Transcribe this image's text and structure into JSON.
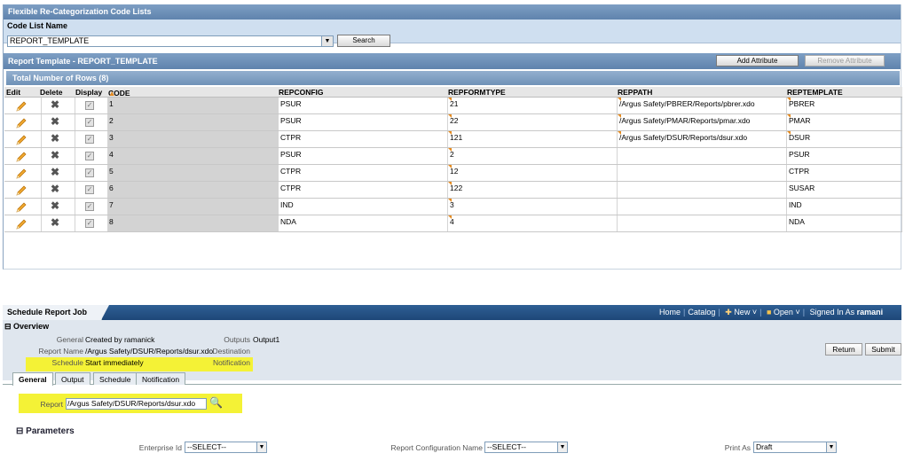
{
  "top": {
    "title": "Flexible Re-Categorization Code Lists",
    "code_list_label": "Code List Name",
    "code_list_value": "REPORT_TEMPLATE",
    "search_label": "Search",
    "report_template_title": "Report Template - REPORT_TEMPLATE",
    "add_attribute_label": "Add Attribute",
    "remove_attribute_label": "Remove Attribute",
    "total_rows": "Total Number of Rows (8)",
    "columns": [
      "Edit",
      "Delete",
      "Display",
      "CODE",
      "REPCONFIG",
      "REPFORMTYPE",
      "REPPATH",
      "REPTEMPLATE"
    ],
    "rows": [
      {
        "code": "1",
        "repconfig": "PSUR",
        "repformtype": "21",
        "reppath": "/Argus Safety/PBRER/Reports/pbrer.xdo",
        "reptemplate": "PBRER"
      },
      {
        "code": "2",
        "repconfig": "PSUR",
        "repformtype": "22",
        "reppath": "/Argus Safety/PMAR/Reports/pmar.xdo",
        "reptemplate": "PMAR"
      },
      {
        "code": "3",
        "repconfig": "CTPR",
        "repformtype": "121",
        "reppath": "/Argus Safety/DSUR/Reports/dsur.xdo",
        "reptemplate": "DSUR"
      },
      {
        "code": "4",
        "repconfig": "PSUR",
        "repformtype": "2",
        "reppath": "",
        "reptemplate": "PSUR"
      },
      {
        "code": "5",
        "repconfig": "CTPR",
        "repformtype": "12",
        "reppath": "",
        "reptemplate": "CTPR"
      },
      {
        "code": "6",
        "repconfig": "CTPR",
        "repformtype": "122",
        "reppath": "",
        "reptemplate": "SUSAR"
      },
      {
        "code": "7",
        "repconfig": "IND",
        "repformtype": "3",
        "reppath": "",
        "reptemplate": "IND"
      },
      {
        "code": "8",
        "repconfig": "NDA",
        "repformtype": "4",
        "reppath": "",
        "reptemplate": "NDA"
      }
    ]
  },
  "bottom": {
    "tab_title": "Schedule Report Job",
    "nav": {
      "home": "Home",
      "catalog": "Catalog",
      "new": "New",
      "open": "Open",
      "signed_in": "Signed In As",
      "user": "ramani"
    },
    "overview_title": "Overview",
    "general_label": "General",
    "general_value": "Created by ramanick",
    "outputs_label": "Outputs",
    "outputs_value": "Output1",
    "report_name_label": "Report Name",
    "report_name_value": "/Argus Safety/DSUR/Reports/dsur.xdo",
    "destination_label": "Destination",
    "schedule_label": "Schedule",
    "schedule_value": "Start immediately",
    "notification_label": "Notification",
    "return_label": "Return",
    "submit_label": "Submit",
    "tabs": [
      "General",
      "Output",
      "Schedule",
      "Notification"
    ],
    "report_label": "Report",
    "report_value": "/Argus Safety/DSUR/Reports/dsur.xdo",
    "parameters_title": "Parameters",
    "enterprise_label": "Enterprise Id",
    "enterprise_value": "--SELECT--",
    "repconfig_label": "Report Configuration Name",
    "repconfig_value": "--SELECT--",
    "print_as_label": "Print As",
    "print_as_value": "Draft"
  },
  "colors": {
    "header_blue": "#5f83ad",
    "highlight_yellow": "#f4f236",
    "flag_orange": "#e48a1f"
  }
}
